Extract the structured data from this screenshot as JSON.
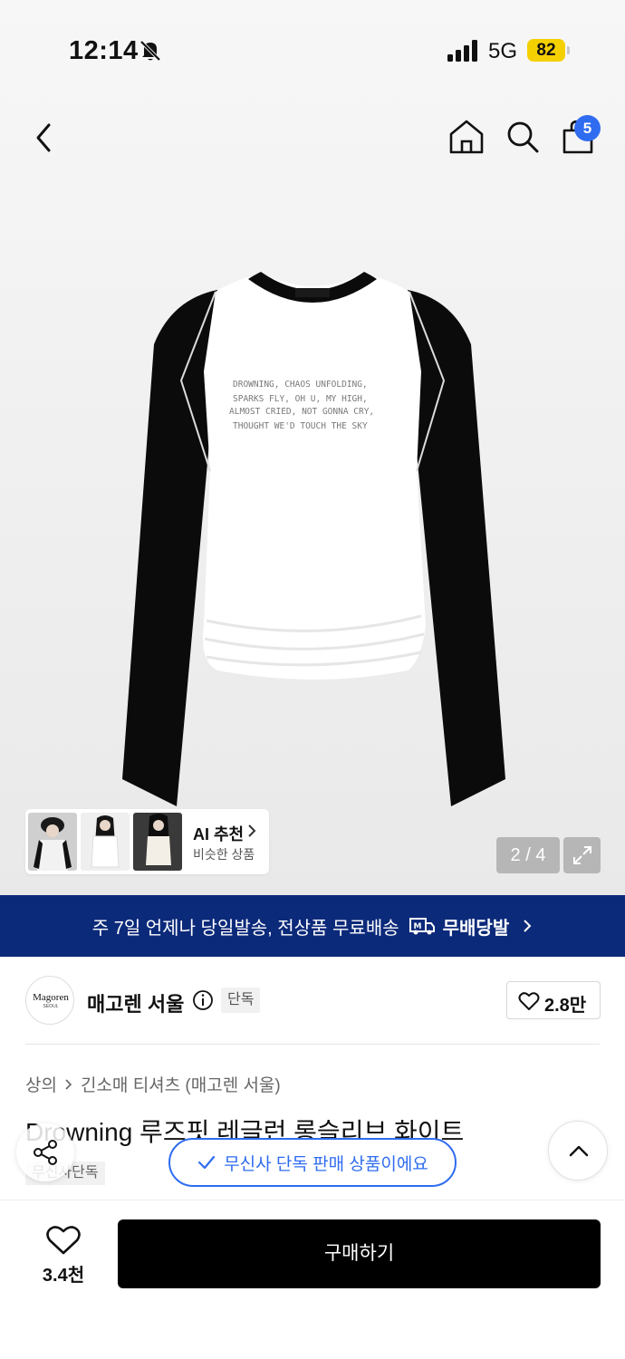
{
  "status_bar": {
    "time": "12:14",
    "network": "5G",
    "battery": "82"
  },
  "header": {
    "cart_count": "5",
    "icons": [
      "back-icon",
      "home-icon",
      "search-icon",
      "bag-icon"
    ]
  },
  "gallery": {
    "page_counter": "2 / 4",
    "shirt_print_lines": [
      "DROWNING, CHAOS UNFOLDING,",
      "SPARKS FLY, OH U, MY HIGH,",
      "ALMOST CRIED, NOT GONNA CRY,",
      "THOUGHT WE'D TOUCH THE SKY"
    ],
    "ai_reco": {
      "title": "AI 추천",
      "subtitle": "비슷한 상품"
    }
  },
  "delivery_banner": {
    "text": "주 7일 언제나 당일발송, 전상품 무료배송",
    "brand": "무배당발"
  },
  "brand": {
    "logo_text": "Magoren",
    "logo_sub": "SEOUL",
    "name": "매고렌 서울",
    "tag": "단독",
    "like_count": "2.8만"
  },
  "product": {
    "breadcrumb": [
      "상의",
      "긴소매 티셔츠 (매고렌 서울)"
    ],
    "title": "Drowning 루즈핏 레글런 롱슬리브 화이트",
    "exclusive_label": "무신사단독"
  },
  "toast": {
    "text": "무신사 단독 판매 상품이에요"
  },
  "bottom_bar": {
    "wish_count": "3.4천",
    "buy_label": "구매하기"
  },
  "colors": {
    "banner": "#0c2a7a",
    "accent": "#2f6cf0",
    "battery": "#f5d000",
    "buy_button": "#000000"
  }
}
